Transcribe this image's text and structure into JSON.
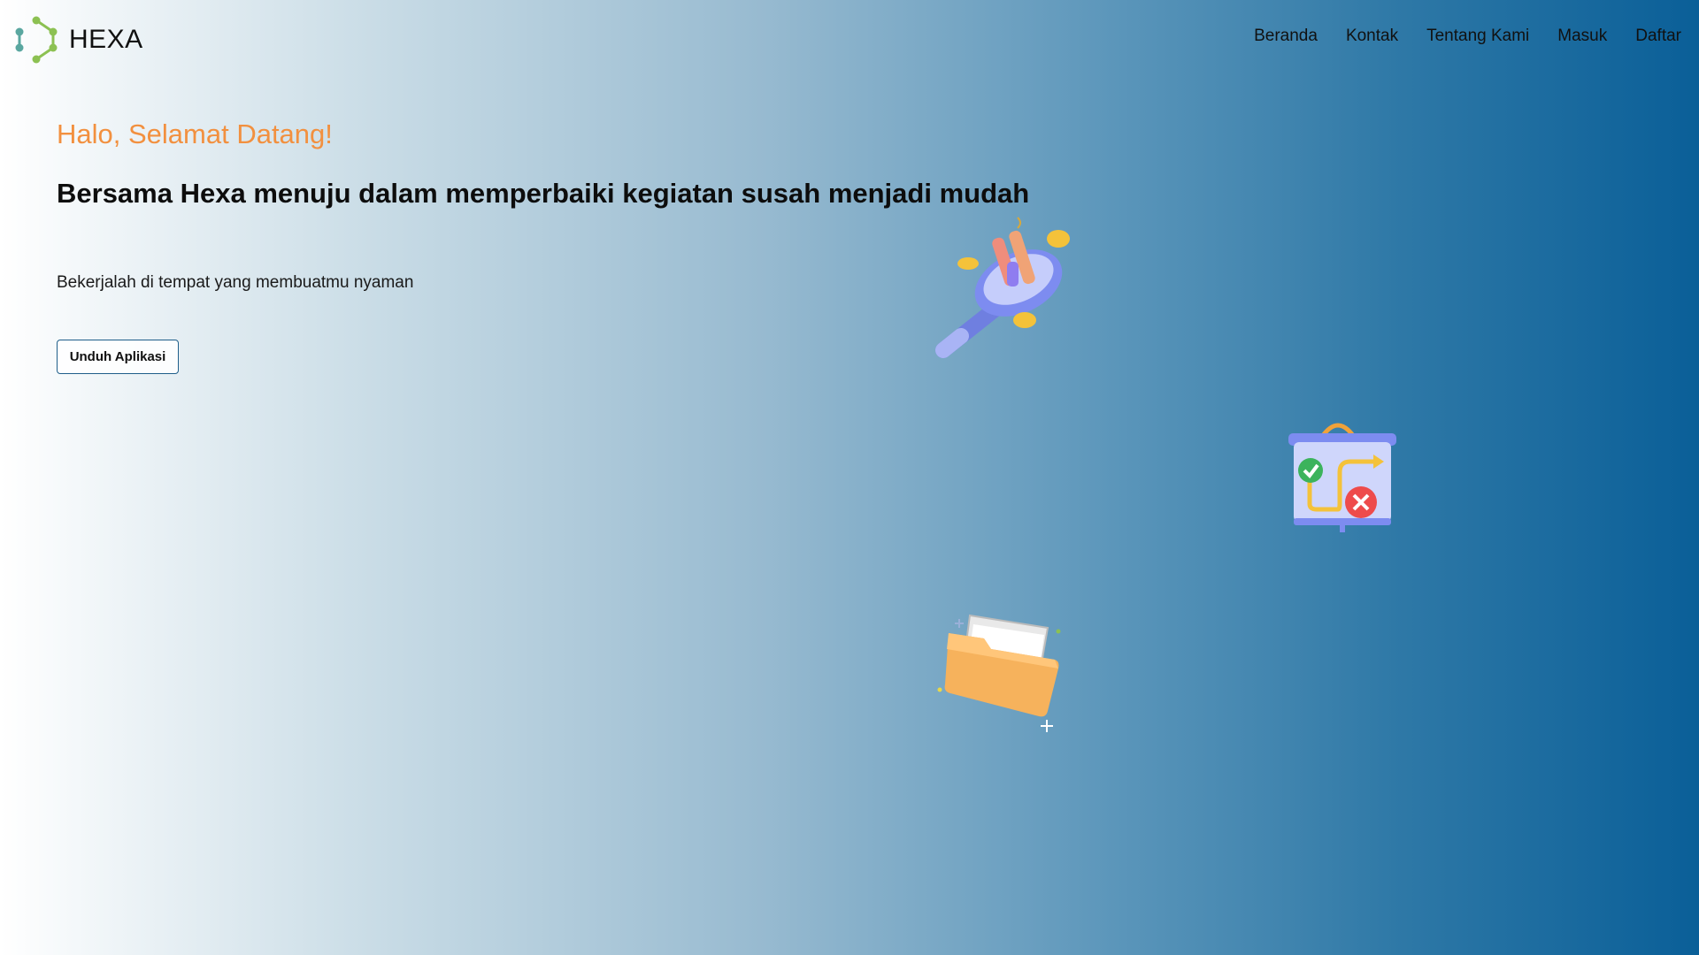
{
  "brand": {
    "name": "HEXA",
    "logo_icon": "hexagon-dots-logo"
  },
  "nav": {
    "items": [
      {
        "label": "Beranda"
      },
      {
        "label": "Kontak"
      },
      {
        "label": "Tentang Kami"
      },
      {
        "label": "Masuk"
      },
      {
        "label": "Daftar"
      }
    ]
  },
  "hero": {
    "greeting": "Halo, Selamat Datang!",
    "headline": "Bersama Hexa menuju dalam memperbaiki kegiatan susah menjadi mudah",
    "subtitle": "Bekerjalah di tempat yang membuatmu nyaman",
    "cta_label": "Unduh Aplikasi"
  },
  "illustrations": [
    {
      "icon": "magnifier-chart-icon"
    },
    {
      "icon": "presentation-board-icon"
    },
    {
      "icon": "folder-icon"
    }
  ],
  "colors": {
    "greeting": "#f2903f",
    "gradient_start": "#ffffff",
    "gradient_end": "#0a5f98",
    "button_border": "#1f5e8a"
  }
}
